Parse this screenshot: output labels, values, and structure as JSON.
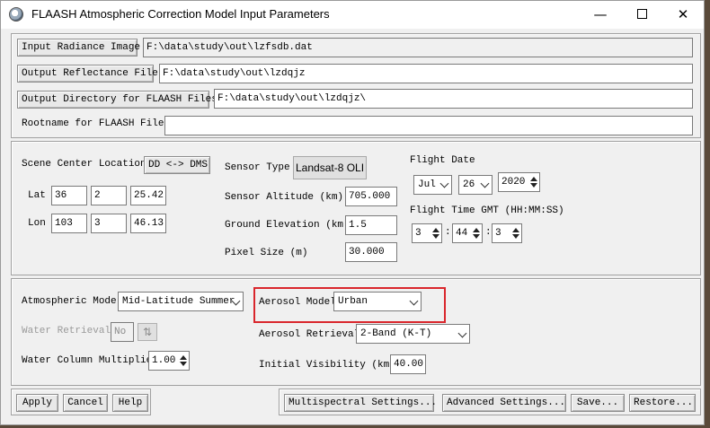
{
  "window": {
    "title": "FLAASH Atmospheric Correction Model Input Parameters",
    "controls": {
      "minimize": "—",
      "close": "✕"
    }
  },
  "files": {
    "input_button": "Input Radiance Image",
    "input_value": "F:\\data\\study\\out\\lzfsdb.dat",
    "output_button": "Output Reflectance File",
    "output_value": "F:\\data\\study\\out\\lzdqjz",
    "outdir_button": "Output Directory for FLAASH Files",
    "outdir_value": "F:\\data\\study\\out\\lzdqjz\\",
    "rootname_label": "Rootname for FLAASH Files",
    "rootname_value": ""
  },
  "scene": {
    "center_label": "Scene Center Location",
    "dd_dms_button": "DD <-> DMS",
    "lat_label": "Lat",
    "lat": [
      "36",
      "2",
      "25.42"
    ],
    "lon_label": "Lon",
    "lon": [
      "103",
      "3",
      "46.13"
    ],
    "sensor_type_label": "Sensor Type",
    "sensor_type_value": "Landsat-8 OLI",
    "sensor_altitude_label": "Sensor Altitude (km)",
    "sensor_altitude_value": "705.000",
    "ground_elevation_label": "Ground Elevation (km)",
    "ground_elevation_value": "1.5",
    "pixel_size_label": "Pixel Size (m)",
    "pixel_size_value": "30.000",
    "flight_date_label": "Flight Date",
    "flight_month": "Jul",
    "flight_day": "26",
    "flight_year": "2020",
    "flight_time_label": "Flight Time GMT (HH:MM:SS)",
    "time_hh": "3",
    "time_mm": "44",
    "time_ss": "3",
    "time_sep": ":"
  },
  "atmos": {
    "model_label": "Atmospheric Model",
    "model_value": "Mid-Latitude Summer",
    "water_retrieval_label": "Water Retrieval",
    "water_retrieval_value": "No",
    "water_column_label": "Water Column Multiplier",
    "water_column_value": "1.00",
    "aerosol_model_label": "Aerosol Model",
    "aerosol_model_value": "Urban",
    "aerosol_retrieval_label": "Aerosol Retrieval",
    "aerosol_retrieval_value": "2-Band (K-T)",
    "visibility_label": "Initial Visibility (km)",
    "visibility_value": "40.00"
  },
  "footer": {
    "apply": "Apply",
    "cancel": "Cancel",
    "help": "Help",
    "multispectral": "Multispectral Settings...",
    "advanced": "Advanced Settings...",
    "save": "Save...",
    "restore": "Restore..."
  },
  "colors": {
    "highlight": "#d9262c",
    "window_bg": "#f0f0f0"
  }
}
